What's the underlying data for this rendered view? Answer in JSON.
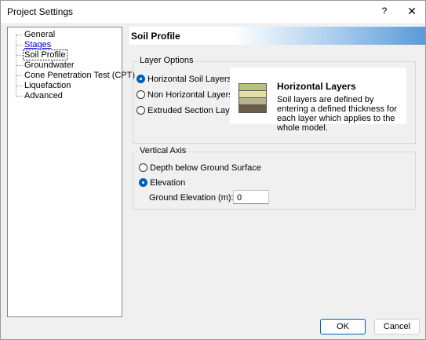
{
  "window": {
    "title": "Project Settings",
    "help_glyph": "?",
    "close_glyph": "✕"
  },
  "sidebar": {
    "items": [
      {
        "label": "General"
      },
      {
        "label": "Stages"
      },
      {
        "label": "Soil Profile"
      },
      {
        "label": "Groundwater"
      },
      {
        "label": "Cone Penetration Test (CPT)"
      },
      {
        "label": "Liquefaction"
      },
      {
        "label": "Advanced"
      }
    ],
    "selected": "Soil Profile"
  },
  "panel": {
    "title": "Soil Profile"
  },
  "layer_options": {
    "legend": "Layer Options",
    "options": [
      {
        "label": "Horizontal Soil Layers",
        "checked": true
      },
      {
        "label": "Non Horizontal Layers",
        "checked": false
      },
      {
        "label": "Extruded Section Layers",
        "checked": false
      }
    ],
    "info": {
      "title": "Horizontal Layers",
      "description": "Soil layers are defined by entering a defined thickness for each layer which applies to the whole model.",
      "layer_colors": [
        "#b6c27a",
        "#e4dfa6",
        "#bab28c",
        "#6a5d4a"
      ]
    }
  },
  "vertical_axis": {
    "legend": "Vertical Axis",
    "options": [
      {
        "label": "Depth below Ground Surface",
        "checked": false
      },
      {
        "label": "Elevation",
        "checked": true
      }
    ],
    "ground_elevation_label": "Ground Elevation (m):",
    "ground_elevation_value": "0"
  },
  "buttons": {
    "ok": "OK",
    "cancel": "Cancel"
  }
}
